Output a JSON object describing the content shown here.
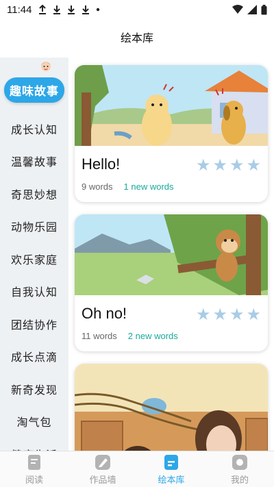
{
  "status": {
    "time": "11:44",
    "left_icons": [
      "upload-icon",
      "download-icon",
      "download-icon",
      "download-icon",
      "dot-icon"
    ],
    "right_icons": [
      "wifi-icon",
      "signal-icon",
      "battery-icon"
    ]
  },
  "header": {
    "title": "绘本库"
  },
  "categories": {
    "active": "趣味故事",
    "items": [
      "成长认知",
      "温馨故事",
      "奇思妙想",
      "动物乐园",
      "欢乐家庭",
      "自我认知",
      "团结协作",
      "成长点滴",
      "新奇发现",
      "淘气包",
      "健康生活"
    ]
  },
  "cards": [
    {
      "title": "Hello!",
      "words": "9 words",
      "new_words": "1 new words",
      "stars": 4
    },
    {
      "title": "Oh no!",
      "words": "11 words",
      "new_words": "2 new words",
      "stars": 4
    }
  ],
  "tabs": [
    {
      "label": "阅读",
      "icon": "book-icon"
    },
    {
      "label": "作品墙",
      "icon": "pencil-icon"
    },
    {
      "label": "绘本库",
      "icon": "library-icon",
      "active": true
    },
    {
      "label": "我的",
      "icon": "profile-icon"
    }
  ],
  "colors": {
    "accent": "#2da7e8",
    "new_words": "#19a99a",
    "star": "#a9cce6",
    "sidebar_bg": "#eef1f4"
  }
}
